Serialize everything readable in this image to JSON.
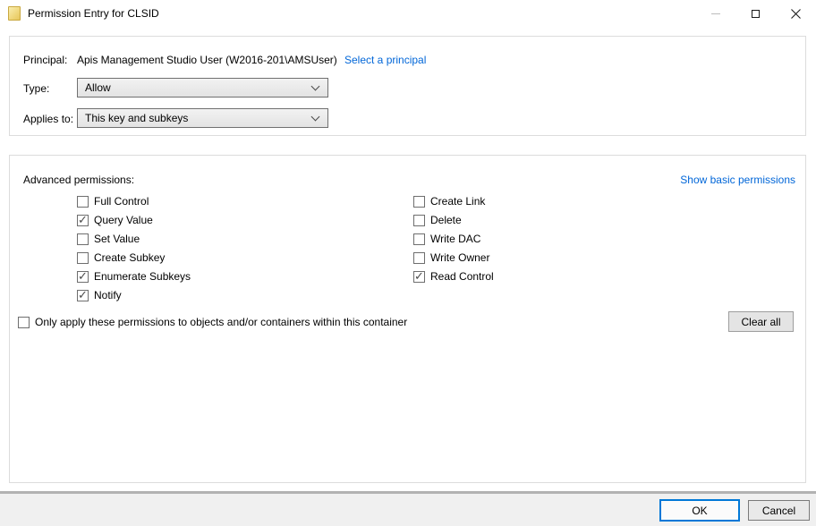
{
  "window": {
    "title": "Permission Entry for CLSID"
  },
  "principal": {
    "label": "Principal:",
    "value": "Apis Management Studio User (W2016-201\\AMSUser)",
    "link": "Select a principal"
  },
  "type_row": {
    "label": "Type:",
    "value": "Allow"
  },
  "applies_row": {
    "label": "Applies to:",
    "value": "This key and subkeys"
  },
  "permissions": {
    "header": "Advanced permissions:",
    "link": "Show basic permissions",
    "left": [
      {
        "label": "Full Control",
        "checked": false
      },
      {
        "label": "Query Value",
        "checked": true
      },
      {
        "label": "Set Value",
        "checked": false
      },
      {
        "label": "Create Subkey",
        "checked": false
      },
      {
        "label": "Enumerate Subkeys",
        "checked": true
      },
      {
        "label": "Notify",
        "checked": true
      }
    ],
    "right": [
      {
        "label": "Create Link",
        "checked": false
      },
      {
        "label": "Delete",
        "checked": false
      },
      {
        "label": "Write DAC",
        "checked": false
      },
      {
        "label": "Write Owner",
        "checked": false
      },
      {
        "label": "Read Control",
        "checked": true
      }
    ]
  },
  "only_apply": {
    "label": "Only apply these permissions to objects and/or containers within this container",
    "checked": false
  },
  "buttons": {
    "clear_all": "Clear all",
    "ok": "OK",
    "cancel": "Cancel"
  },
  "colors": {
    "link_blue": "#0166d8",
    "accent_blue": "#0078d7",
    "footer_gray": "#f0f0f0"
  }
}
